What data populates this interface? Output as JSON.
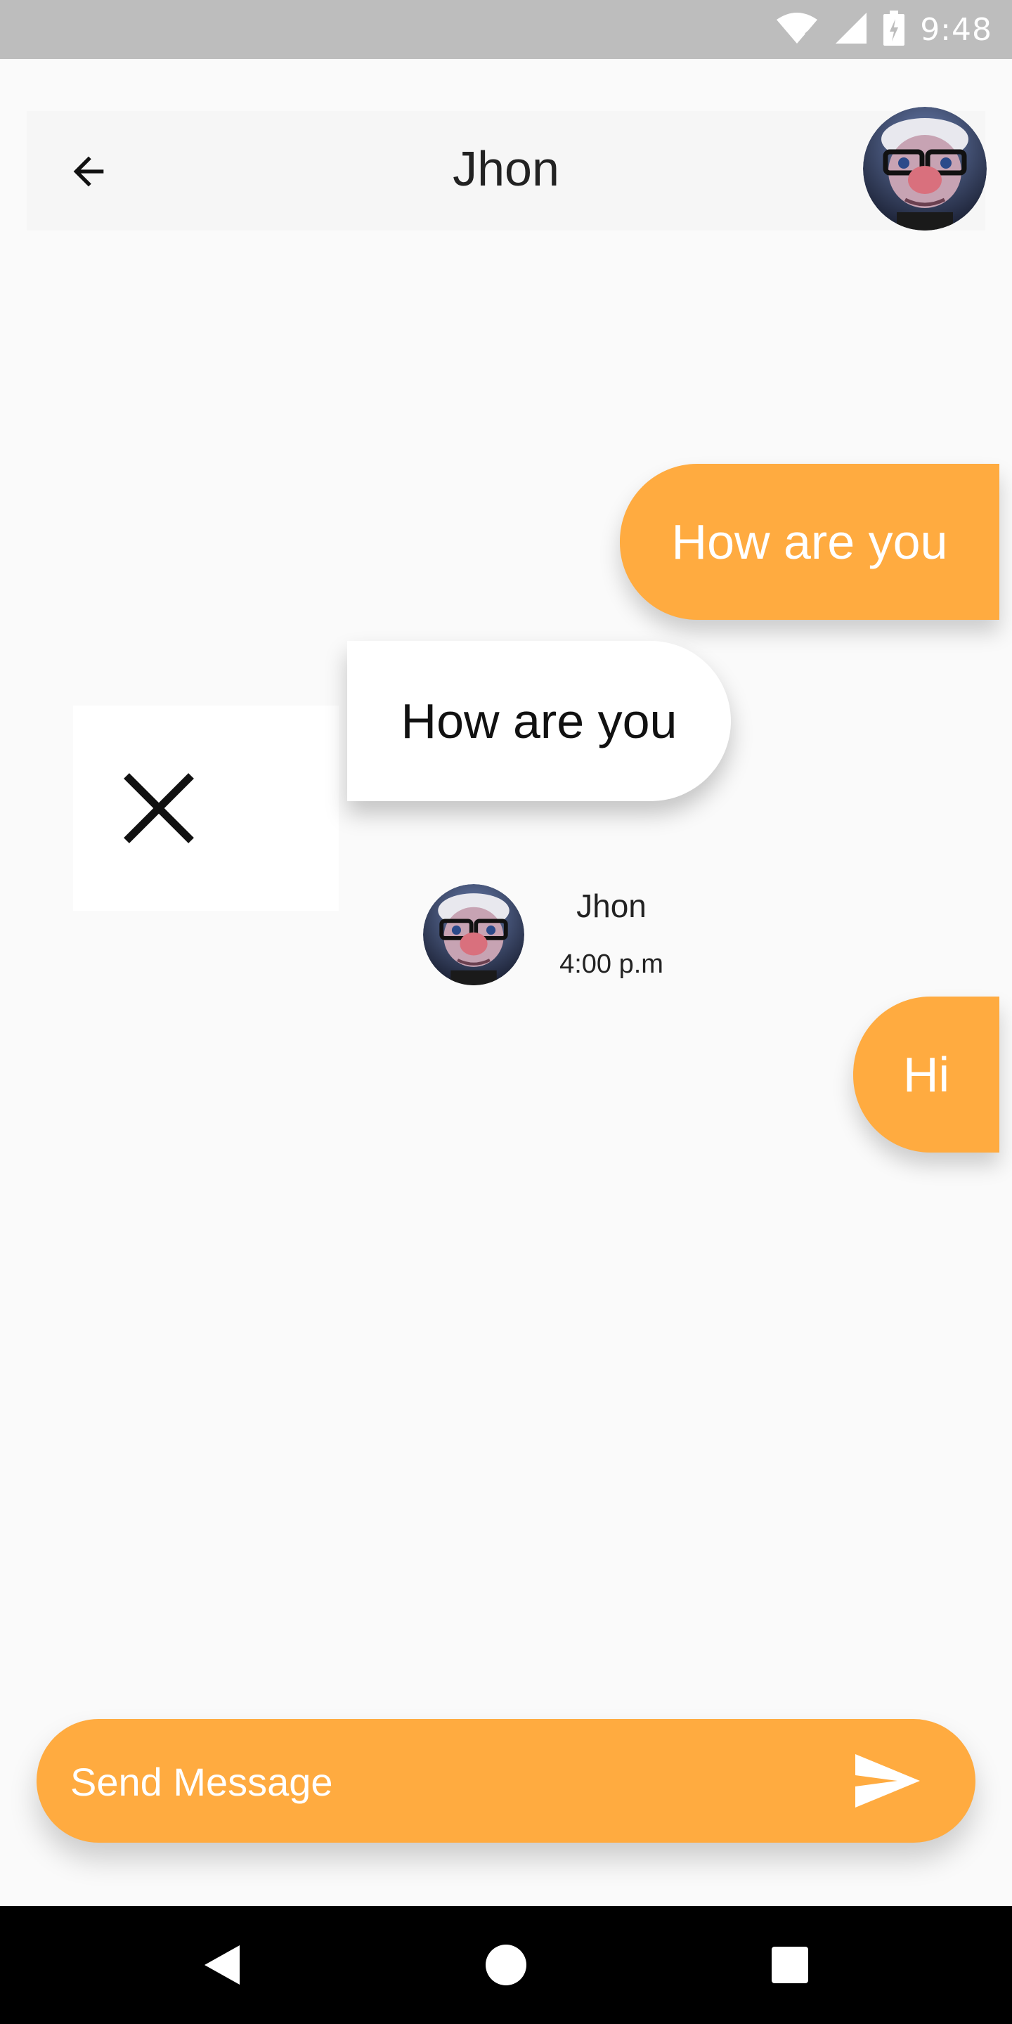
{
  "status_bar": {
    "time": "9:48"
  },
  "header": {
    "title": "Jhon"
  },
  "messages": [
    {
      "direction": "outgoing",
      "text": "How are you"
    },
    {
      "direction": "incoming",
      "text": "How are you"
    },
    {
      "direction": "outgoing",
      "text": "Hi"
    }
  ],
  "sender": {
    "name": "Jhon",
    "time": "4:00 p.m"
  },
  "composer": {
    "placeholder": "Send Message"
  },
  "colors": {
    "accent": "#ffab40",
    "background": "#fafafa"
  }
}
